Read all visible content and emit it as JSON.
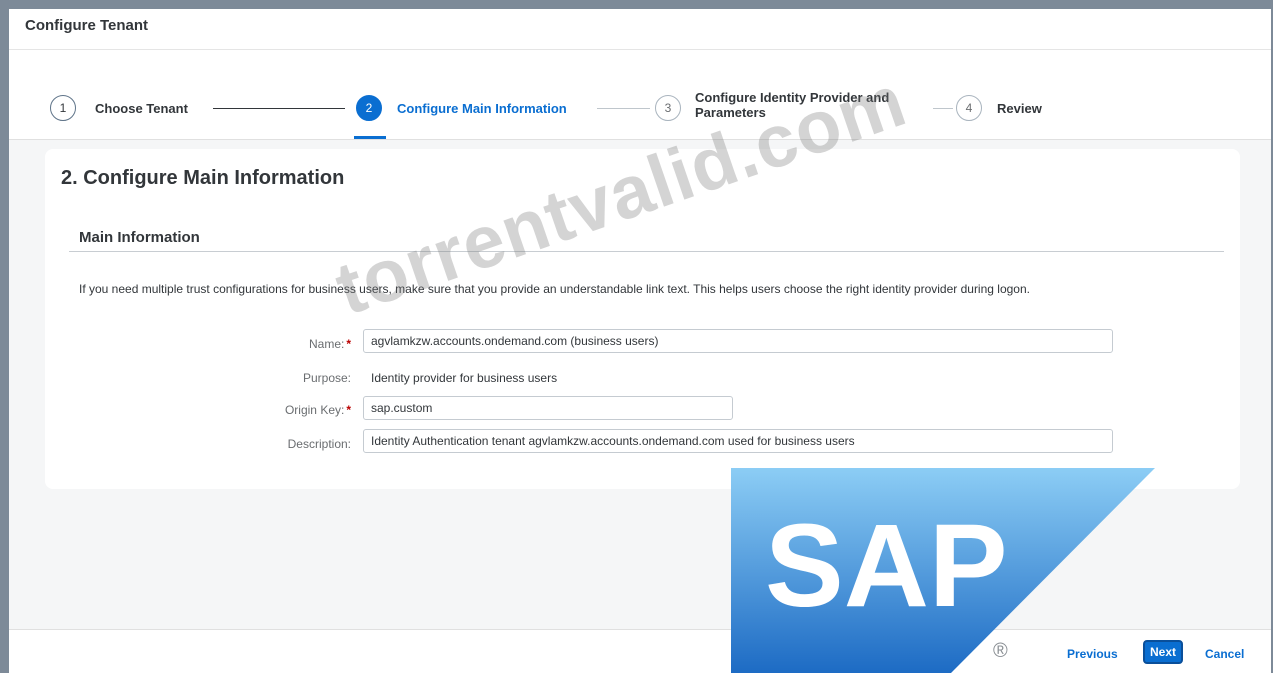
{
  "window": {
    "title": "Configure Tenant"
  },
  "wizard": {
    "steps": [
      {
        "number": "1",
        "label": "Choose Tenant",
        "state": "completed"
      },
      {
        "number": "2",
        "label": "Configure Main Information",
        "state": "active"
      },
      {
        "number": "3",
        "label_line1": "Configure Identity Provider and",
        "label_line2": "Parameters",
        "state": "inactive"
      },
      {
        "number": "4",
        "label": "Review",
        "state": "inactive"
      }
    ]
  },
  "main": {
    "heading": "2. Configure Main Information",
    "section": "Main Information",
    "info": "If you need multiple trust configurations for business users, make sure that you provide an understandable link text. This helps users choose the right identity provider during logon.",
    "fields": {
      "name": {
        "label": "Name:",
        "value": "agvlamkzw.accounts.ondemand.com (business users)"
      },
      "purpose": {
        "label": "Purpose:",
        "value": "Identity provider for business users"
      },
      "origin_key": {
        "label": "Origin Key:",
        "value": "sap.custom"
      },
      "description": {
        "label": "Description:",
        "value": "Identity Authentication tenant agvlamkzw.accounts.ondemand.com used for business users"
      }
    },
    "required_marker": "*"
  },
  "footer": {
    "previous": "Previous",
    "next": "Next",
    "cancel": "Cancel"
  },
  "watermark": "torrentvalid.com",
  "logo": {
    "text": "SAP",
    "registered": "®"
  },
  "colors": {
    "accent": "#0a6ed1",
    "required": "#bb0000",
    "logo_blue_top": "#8ccdf5",
    "logo_blue_bottom": "#1d6bc4"
  }
}
